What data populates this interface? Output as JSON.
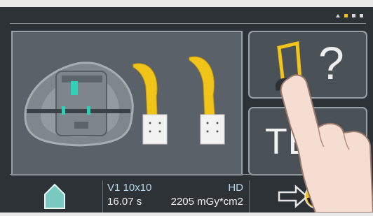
{
  "status": {
    "indicators": [
      "triangle",
      "active",
      "square",
      "square"
    ]
  },
  "main": {
    "image": "dental-phantom-and-bite-blocks"
  },
  "side": {
    "help_button_label": "?",
    "te_button_label": "TE"
  },
  "footer": {
    "info_line1_left": "V1 10x10",
    "info_line1_right": "HD",
    "info_line2_left": "16.07 s",
    "info_line2_right": "2205 mGy*cm2",
    "home_icon": "home-icon",
    "expose_icon": "radiation-expose-icon"
  },
  "colors": {
    "accent": "#f3c21b",
    "info_text": "#b9d8ec",
    "panel_bg": "#5a6168",
    "screen_bg": "#2d3236"
  }
}
